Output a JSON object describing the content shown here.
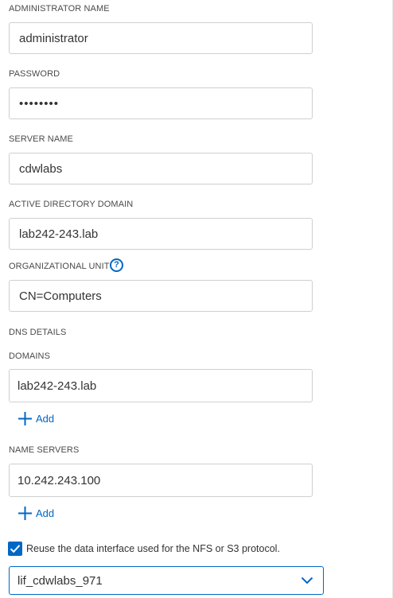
{
  "admin_name": {
    "label": "ADMINISTRATOR NAME",
    "value": "administrator"
  },
  "password": {
    "label": "PASSWORD",
    "value": "••••••••"
  },
  "server_name": {
    "label": "SERVER NAME",
    "value": "cdwlabs"
  },
  "ad_domain": {
    "label": "ACTIVE DIRECTORY DOMAIN",
    "value": "lab242-243.lab"
  },
  "org_unit": {
    "label": "ORGANIZATIONAL UNIT",
    "value": "CN=Computers",
    "help_glyph": "?"
  },
  "dns": {
    "section_label": "DNS DETAILS",
    "domains_label": "DOMAINS",
    "domain_value": "lab242-243.lab",
    "domains_add": "Add",
    "name_servers_label": "NAME SERVERS",
    "name_server_value": "10.242.243.100",
    "name_servers_add": "Add"
  },
  "reuse": {
    "checked": true,
    "label": "Reuse the data interface used for the NFS or S3 protocol."
  },
  "interface_select": {
    "value": "lif_cdwlabs_971"
  },
  "colors": {
    "accent": "#0067c5",
    "border": "#cfcfcf",
    "text": "#333333"
  },
  "icons": {
    "help": "question-circle-icon",
    "add": "plus-icon",
    "check": "check-icon",
    "dropdown": "chevron-down-icon"
  }
}
